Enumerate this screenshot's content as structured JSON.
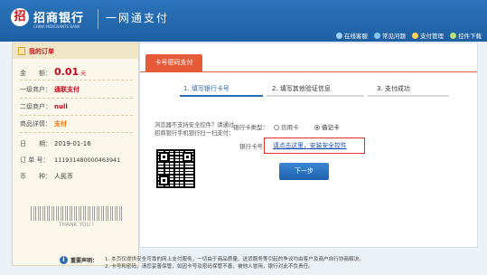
{
  "header": {
    "logo_mark": "招",
    "logo_cn": "招商银行",
    "logo_en": "CHINA MERCHANTS BANK",
    "slogan": "一网通支付",
    "nav": [
      {
        "label": "在线客服",
        "icon": "headset-icon"
      },
      {
        "label": "常见问题",
        "icon": "question-icon"
      },
      {
        "label": "支付管理",
        "icon": "gear-icon"
      },
      {
        "label": "控件下载",
        "icon": "download-icon"
      }
    ]
  },
  "order": {
    "title": "我的订单",
    "rows": [
      {
        "label": "金　　额：",
        "value": "0.01",
        "unit": "元"
      },
      {
        "label": "一级商户：",
        "value": "通联支付"
      },
      {
        "label": "二级商户：",
        "value": "null"
      },
      {
        "label": "商品详情：",
        "value": "支付"
      },
      {
        "label": "日　　期：",
        "value": "2019-01-16"
      },
      {
        "label": "订 单 号：",
        "value": "111931480000463941"
      },
      {
        "label": "币　　种：",
        "value": "人民币"
      }
    ],
    "thank_you": "THANK YOU !"
  },
  "pay": {
    "tab_label": "卡号密码支付",
    "steps": [
      "1. 填写银行卡号",
      "2. 填写其他验证信息",
      "3. 支付成功"
    ],
    "hint": "浏览器不支持安全控件？请通过招商银行手机银行扫一扫支付：",
    "card_type_label": "银行卡类型：",
    "card_types": [
      {
        "label": "信用卡",
        "checked": false
      },
      {
        "label": "借记卡",
        "checked": true
      }
    ],
    "card_number_label": "银行卡号：",
    "install_link": "请点击这里，安装安全控件",
    "next_button": "下一步"
  },
  "footer": {
    "icon": "i",
    "title": "重要声明：",
    "lines": [
      "1. 本页仅提供安全可靠的网上支付服务，一切由于商品质量、送货服务等引起的争议均由客户及商户自行协商解决。",
      "2. 卡号和密码，请您妥善保管，如因卡号及密码保管不善，被他人冒用，银行对此不负责任。"
    ]
  }
}
